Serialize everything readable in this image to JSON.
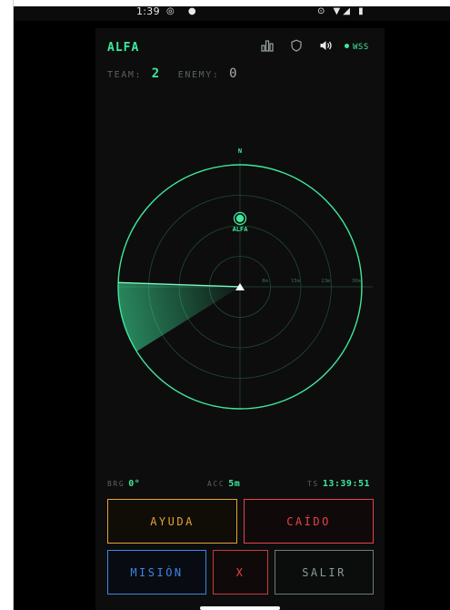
{
  "status_bar": {
    "time": "1:39",
    "left_icons": "◎ ●",
    "right_icons": "⊙ ▼◢ ▮"
  },
  "header": {
    "callsign": "ALFA",
    "icons": [
      "chart-icon",
      "shield-icon",
      "speaker-icon"
    ],
    "connection_label": "WSS",
    "connection_color": "#3ee89d"
  },
  "teams": {
    "team_label": "TEAM:",
    "team_count": "2",
    "enemy_label": "ENEMY:",
    "enemy_count": "0"
  },
  "radar": {
    "north_label": "N",
    "ring_labels": [
      "8m",
      "15m",
      "23m",
      "30m"
    ],
    "max_range_m": 30,
    "sweep_bearing_deg": 272,
    "contacts": [
      {
        "label": "ALFA",
        "bearing_deg": 0,
        "range_m": 16.8
      }
    ],
    "accent_color": "#3ee89d"
  },
  "telemetry": {
    "brg_label": "BRG",
    "brg_value": "0°",
    "acc_label": "ACC",
    "acc_value": "5m",
    "ts_label": "TS",
    "ts_value": "13:39:51"
  },
  "buttons": {
    "ayuda": "AYUDA",
    "caido": "CAÍDO",
    "mision": "MISIÓN",
    "x": "X",
    "salir": "SALIR"
  },
  "colors": {
    "accent": "#3ee89d",
    "help": "#e3a23a",
    "down": "#e4444a",
    "mission": "#3a86e6",
    "exit": "#6a7d70"
  }
}
